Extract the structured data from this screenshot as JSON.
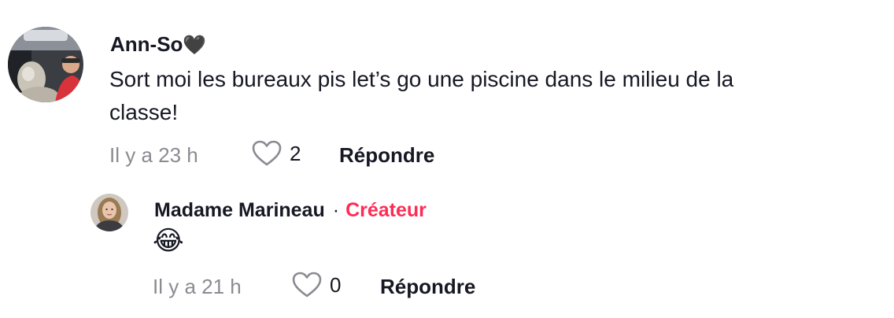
{
  "comment": {
    "username": "Ann-So",
    "username_emoji": "🖤",
    "text": "Sort moi les bureaux pis let’s go une piscine dans le milieu de la\nclasse!",
    "time": "Il y a 23 h",
    "likes": "2",
    "reply_label": "Répondre"
  },
  "reply": {
    "username": "Madame Marineau",
    "separator": "·",
    "badge": "Créateur",
    "text": "😂",
    "time": "Il y a 21 h",
    "likes": "0",
    "reply_label": "Répondre"
  },
  "icons": {
    "like": "heart-outline-icon"
  },
  "colors": {
    "text": "#161823",
    "muted": "#8a8b91",
    "creator": "#fe2c55"
  }
}
